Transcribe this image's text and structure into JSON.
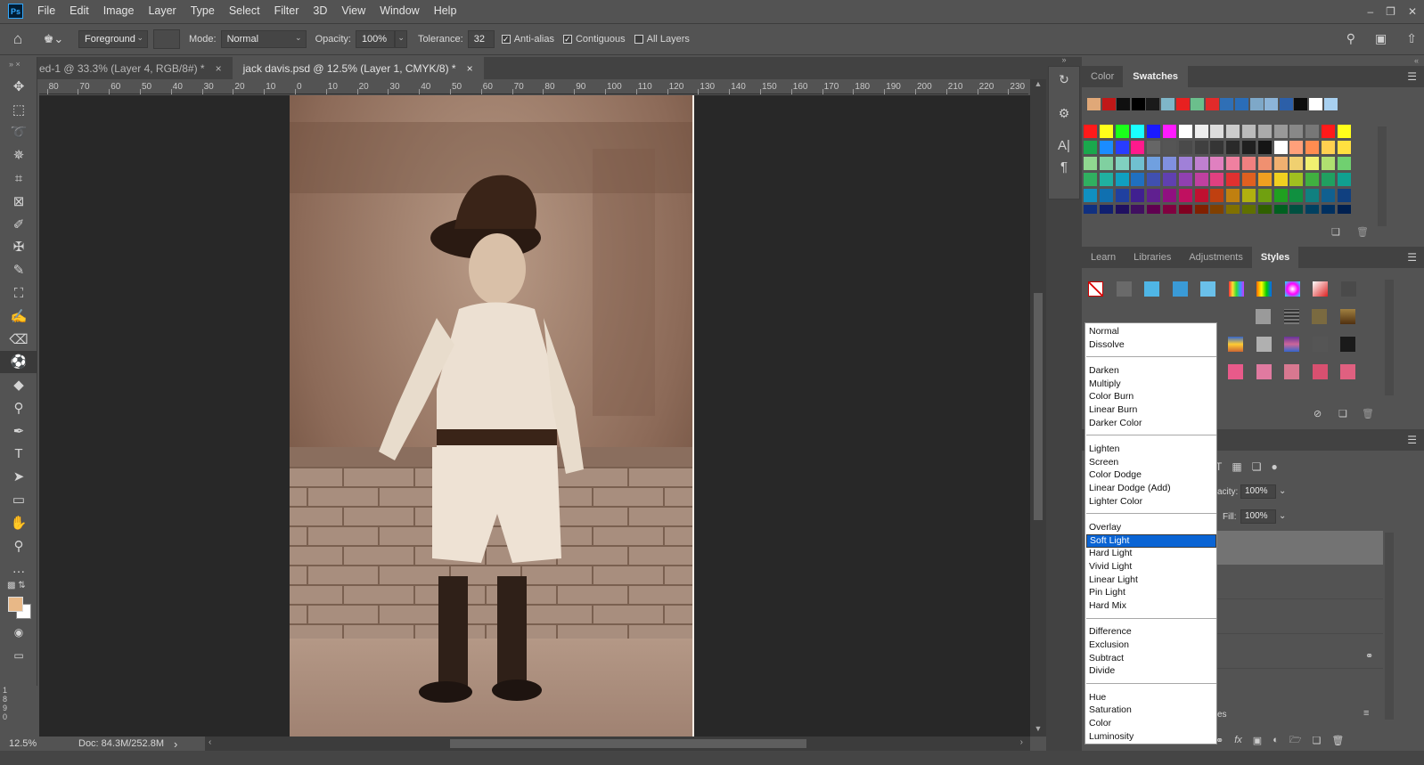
{
  "app": {
    "logo": "Ps"
  },
  "menu": [
    "File",
    "Edit",
    "Image",
    "Layer",
    "Type",
    "Select",
    "Filter",
    "3D",
    "View",
    "Window",
    "Help"
  ],
  "window_controls": [
    "minimize-icon",
    "restore-icon",
    "close-icon"
  ],
  "options": {
    "fill_source": "Foreground",
    "mode_label": "Mode:",
    "mode_value": "Normal",
    "opacity_label": "Opacity:",
    "opacity_value": "100%",
    "tolerance_label": "Tolerance:",
    "tolerance_value": "32",
    "anti_alias": "Anti-alias",
    "anti_alias_checked": true,
    "contiguous": "Contiguous",
    "contiguous_checked": true,
    "all_layers": "All Layers",
    "all_layers_checked": false
  },
  "tools": [
    "move-icon",
    "marquee-icon",
    "lasso-icon",
    "magic-wand-icon",
    "crop-icon",
    "frame-icon",
    "eyedropper-icon",
    "healing-icon",
    "brush-icon",
    "stamp-icon",
    "history-brush-icon",
    "eraser-icon",
    "paint-bucket-icon",
    "blur-icon",
    "dodge-icon",
    "pen-icon",
    "type-icon",
    "path-select-icon",
    "rectangle-icon",
    "hand-icon",
    "zoom-icon",
    "more-tools-icon"
  ],
  "colors": {
    "foreground": "#e8b887",
    "background": "#ffffff",
    "dd_highlight": "#0a64d4"
  },
  "doc_tabs": [
    {
      "label": "ed-1 @ 33.3% (Layer 4, RGB/8#) *",
      "close": "×"
    },
    {
      "label": "jack davis.psd @ 12.5% (Layer 1, CMYK/8) *",
      "close": "×"
    }
  ],
  "ruler_h": [
    "80",
    "70",
    "60",
    "50",
    "40",
    "30",
    "20",
    "10",
    "0",
    "10",
    "20",
    "30",
    "40",
    "50",
    "60",
    "70",
    "80",
    "90",
    "100",
    "110",
    "120",
    "130",
    "140",
    "150",
    "160",
    "170",
    "180",
    "190",
    "200",
    "210",
    "220",
    "230"
  ],
  "ruler_v": [
    "1",
    "8",
    "9",
    "0"
  ],
  "status": {
    "zoom": "12.5%",
    "doc": "Doc: 84.3M/252.8M",
    "arrow": "›"
  },
  "color_panel": {
    "tabs": [
      "Color",
      "Swatches"
    ],
    "active": "Swatches"
  },
  "styles_panel": {
    "tabs": [
      "Learn",
      "Libraries",
      "Adjustments",
      "Styles"
    ],
    "active": "Styles"
  },
  "layers_panel": {
    "opacity_label": "acity:",
    "opacity_value": "100%",
    "fill_label": "Fill:",
    "fill_value": "100%",
    "partial_label": "es"
  },
  "blend_modes": [
    [
      "Normal",
      "Dissolve"
    ],
    [
      "Darken",
      "Multiply",
      "Color Burn",
      "Linear Burn",
      "Darker Color"
    ],
    [
      "Lighten",
      "Screen",
      "Color Dodge",
      "Linear Dodge (Add)",
      "Lighter Color"
    ],
    [
      "Overlay",
      "Soft Light",
      "Hard Light",
      "Vivid Light",
      "Linear Light",
      "Pin Light",
      "Hard Mix"
    ],
    [
      "Difference",
      "Exclusion",
      "Subtract",
      "Divide"
    ],
    [
      "Hue",
      "Saturation",
      "Color",
      "Luminosity"
    ]
  ],
  "selected_blend_mode": "Soft Light",
  "swatches_recent": [
    "#e0a878",
    "#c01818",
    "#101010",
    "#000000",
    "#1a1a1a",
    "#7fb6c8",
    "#e82020",
    "#6bbf8c",
    "#e22a2a",
    "#2f6fb6",
    "#2a6db8",
    "#7ea8c8",
    "#8cb4d8",
    "#2c5fa8",
    "#0c0c0c",
    "#ffffff",
    "#a8d0f0"
  ],
  "swatch_rows": [
    [
      "#ff1a1a",
      "#ffff1a",
      "#1aff1a",
      "#1affff",
      "#1a1aff",
      "#ff1aff",
      "#ffffff",
      "#eeeeee",
      "#dddddd",
      "#cccccc",
      "#bbbbbb",
      "#aaaaaa",
      "#999999",
      "#888888",
      "#777777",
      "#ff1a1a",
      "#ffff1a"
    ],
    [
      "#1aa84c",
      "#1a8cff",
      "#283cff",
      "#ff1a8c",
      "#666666",
      "#555555",
      "#4a4a4a",
      "#404040",
      "#353535",
      "#2a2a2a",
      "#202020",
      "#151515",
      "#ffffff",
      "#ffa07a",
      "#ff8c50",
      "#ffd050",
      "#ffe040"
    ],
    [
      "#90d890",
      "#80d0a0",
      "#80d0c0",
      "#70c0d0",
      "#70a0e0",
      "#8090e0",
      "#a080d8",
      "#c080d0",
      "#e080c0",
      "#f080a0",
      "#f08080",
      "#f09070",
      "#f0b070",
      "#f0d070",
      "#f0f070",
      "#b0e070",
      "#70d070"
    ],
    [
      "#30b060",
      "#20b0a0",
      "#10a0c0",
      "#2070c0",
      "#4050b0",
      "#6040b0",
      "#9040b0",
      "#c040a0",
      "#e04080",
      "#e03030",
      "#e06020",
      "#f0a020",
      "#f0d020",
      "#a0c020",
      "#40b040",
      "#20a060",
      "#10a090"
    ],
    [
      "#1090c0",
      "#1070b0",
      "#2040a0",
      "#402090",
      "#602090",
      "#901080",
      "#c01060",
      "#c01030",
      "#c04010",
      "#c08010",
      "#b0b010",
      "#70a010",
      "#20a020",
      "#109040",
      "#108080",
      "#106090",
      "#104080"
    ],
    [
      "#103080",
      "#102070",
      "#201060",
      "#401060",
      "#600050",
      "#800040",
      "#800020",
      "#802000",
      "#804000",
      "#807000",
      "#607000",
      "#306000",
      "#006020",
      "#005040",
      "#004060",
      "#003060",
      "#002050"
    ]
  ],
  "styles_row1": [
    "none-style-icon",
    "gray-style-icon",
    "blue-style-icon",
    "blue-frame-style-icon",
    "blue-dot-style-icon",
    "rainbow-style-icon",
    "spectrum-style-icon",
    "color-spot-style-icon",
    "red-gloss-style-icon",
    "dark-style-icon"
  ],
  "styles_row2_right": [
    "gray-bevel-style-icon",
    "stripes-style-icon",
    "gold-style-icon",
    "bronze-style-icon"
  ],
  "styles_row3_right": [
    "sunset-style-icon",
    "mosaic-style-icon",
    "purple-band-style-icon",
    "dots-style-icon",
    "black-shape-style-icon"
  ],
  "styles_row4_right": [
    "pink-style-icon",
    "pink-soft-style-icon",
    "pink-texture-style-icon",
    "red-texture-style-icon",
    "rose-style-icon"
  ]
}
